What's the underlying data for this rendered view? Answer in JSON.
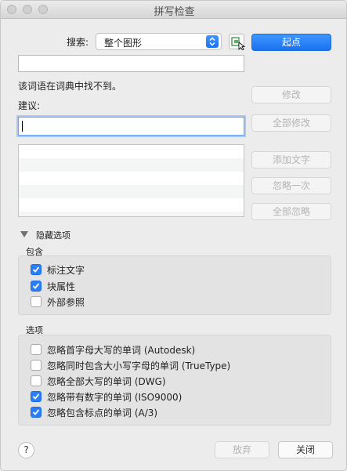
{
  "window": {
    "title": "拼写检查"
  },
  "search": {
    "label": "搜索:",
    "selected": "整个图形"
  },
  "buttons": {
    "start": "起点",
    "modify": "修改",
    "modify_all": "全部修改",
    "add_word": "添加文字",
    "ignore_once": "忽略一次",
    "ignore_all": "全部忽略",
    "abandon": "放弃",
    "close": "关闭",
    "help": "?"
  },
  "message": "该词语在词典中找不到。",
  "suggestion": {
    "label": "建议:",
    "value": ""
  },
  "hide_options": "隐藏选项",
  "include": {
    "title": "包含",
    "items": [
      {
        "label": "标注文字",
        "checked": true
      },
      {
        "label": "块属性",
        "checked": true
      },
      {
        "label": "外部参照",
        "checked": false
      }
    ]
  },
  "options": {
    "title": "选项",
    "items": [
      {
        "label": "忽略首字母大写的单词 (Autodesk)",
        "checked": false
      },
      {
        "label": "忽略同时包含大小写字母的单词 (TrueType)",
        "checked": false
      },
      {
        "label": "忽略全部大写的单词 (DWG)",
        "checked": false
      },
      {
        "label": "忽略带有数字的单词 (ISO9000)",
        "checked": true
      },
      {
        "label": "忽略包含标点的单词 (A/3)",
        "checked": true
      }
    ]
  }
}
